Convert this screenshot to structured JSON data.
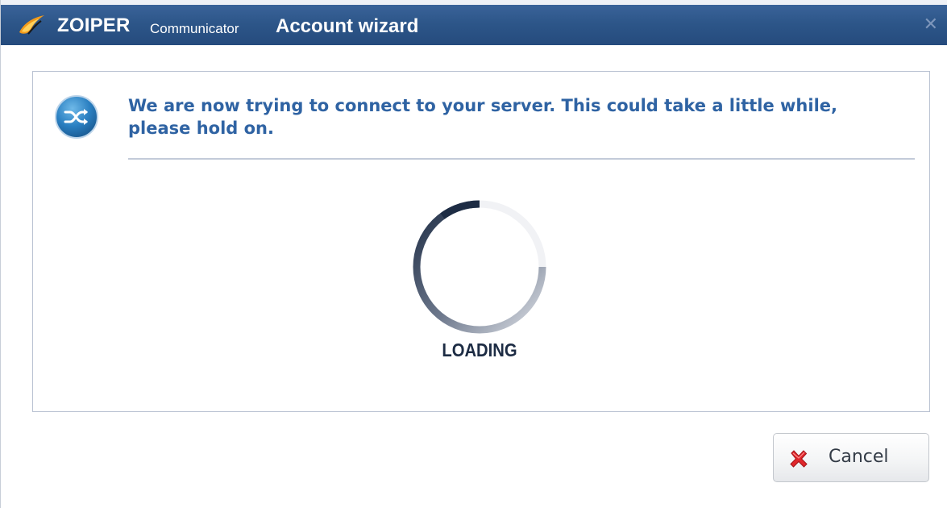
{
  "titlebar": {
    "brand": "ZOIPER",
    "brand_sub": "Communicator",
    "title": "Account wizard",
    "close_glyph": "✕"
  },
  "main": {
    "icon": "shuffle-connect-icon",
    "message": "We are now trying to connect to your server. This could take a little while, please hold on.",
    "loading_label": "LOADING"
  },
  "footer": {
    "cancel_label": "Cancel",
    "cancel_icon": "red-x-icon"
  },
  "colors": {
    "titlebar": "#2d5689",
    "message_text": "#2f63a3",
    "spinner_dark": "#1d2c44",
    "cancel_x": "#e0262b"
  }
}
